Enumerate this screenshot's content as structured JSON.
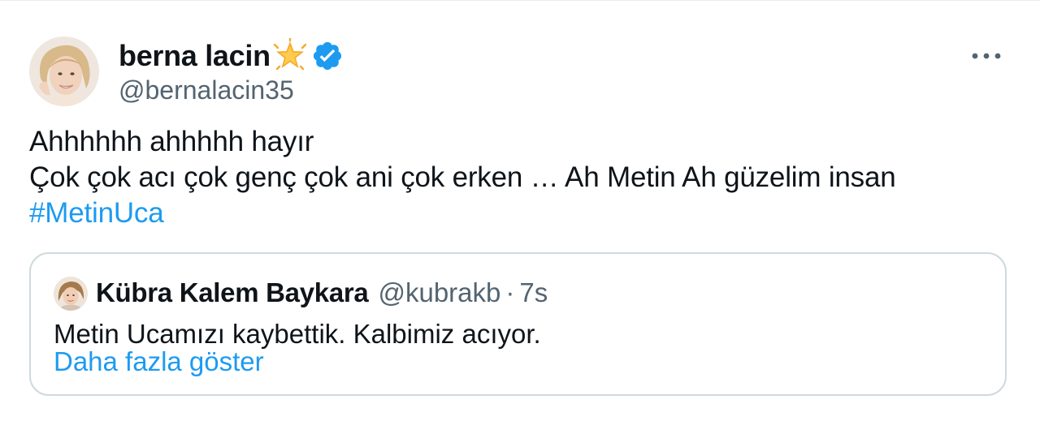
{
  "tweet": {
    "author": {
      "display_name": "berna lacin",
      "handle": "@bernalacin35",
      "emoji": "glowing-star",
      "verified": true
    },
    "text_lines": [
      "Ahhhhhh ahhhhh hayır",
      "Çok çok acı çok genç çok ani çok erken … Ah Metin Ah güzelim insan"
    ],
    "hashtag": "#MetinUca",
    "quoted": {
      "display_name": "Kübra Kalem Baykara",
      "handle": "@kubrakb",
      "separator": "·",
      "time": "7s",
      "text": "Metin Ucamızı kaybettik. Kalbimiz acıyor.",
      "show_more": "Daha fazla göster"
    }
  },
  "colors": {
    "link": "#1d9bf0",
    "secondary_text": "#536471",
    "primary_text": "#0f1419",
    "verified_badge": "#1d9bf0",
    "quote_border": "#cfd9de"
  }
}
